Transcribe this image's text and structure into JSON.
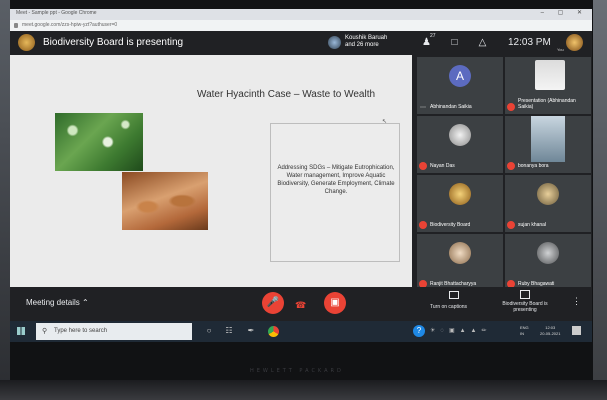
{
  "browser": {
    "tab_title": "Meet - Sample ppt - Google Chrome",
    "url": "meet.google.com/zzs-hpiw-yzt?authuser=0",
    "window_controls": "– ▢ ✕"
  },
  "header": {
    "presenting_label": "Biodiversity Board is presenting",
    "people_chip_name": "Koushik Baruah",
    "people_chip_more": "and 26 more",
    "people_count": "27",
    "clock": "12:03 PM",
    "user_sub": "You"
  },
  "slide": {
    "title": "Water Hyacinth Case – Waste to Wealth",
    "sdg_text": "Addressing SDGs – Mitigate Eutrophication, Water management, Improve Aquatic Biodiversity, Generate Employment, Climate Change."
  },
  "tiles": [
    {
      "name": "Abhinandan Saikia",
      "avatar_letter": "A",
      "avatar_color": "#5c6bc0",
      "muted": false
    },
    {
      "name": "Presentation (Abhinandan Saikia)",
      "avatar_letter": "",
      "avatar_color": "",
      "muted": true
    },
    {
      "name": "Nayan Das",
      "avatar_letter": "",
      "avatar_color": "#cfcfcf",
      "muted": true
    },
    {
      "name": "bonanya bora",
      "avatar_letter": "",
      "avatar_color": "#9fb5c9",
      "muted": true
    },
    {
      "name": "Biodiversity Board",
      "avatar_letter": "",
      "avatar_color": "#e0b050",
      "muted": true
    },
    {
      "name": "sujan khanal",
      "avatar_letter": "",
      "avatar_color": "#c8a46a",
      "muted": true
    },
    {
      "name": "Ranjit Bhattacharyya",
      "avatar_letter": "",
      "avatar_color": "#d9b99a",
      "muted": true
    },
    {
      "name": "Ruby Bhagawati",
      "avatar_letter": "",
      "avatar_color": "#a0a3a6",
      "muted": true
    }
  ],
  "bottom_bar": {
    "meeting_details": "Meeting details",
    "captions_label": "Turn on captions",
    "present_label": "Biodiversity Board is presenting"
  },
  "taskbar": {
    "search_placeholder": "Type here to search",
    "lang": "ENG\nIN",
    "time": "12:03",
    "date": "20-05-2021"
  },
  "device": {
    "brand": "HEWLETT PACKARD"
  }
}
